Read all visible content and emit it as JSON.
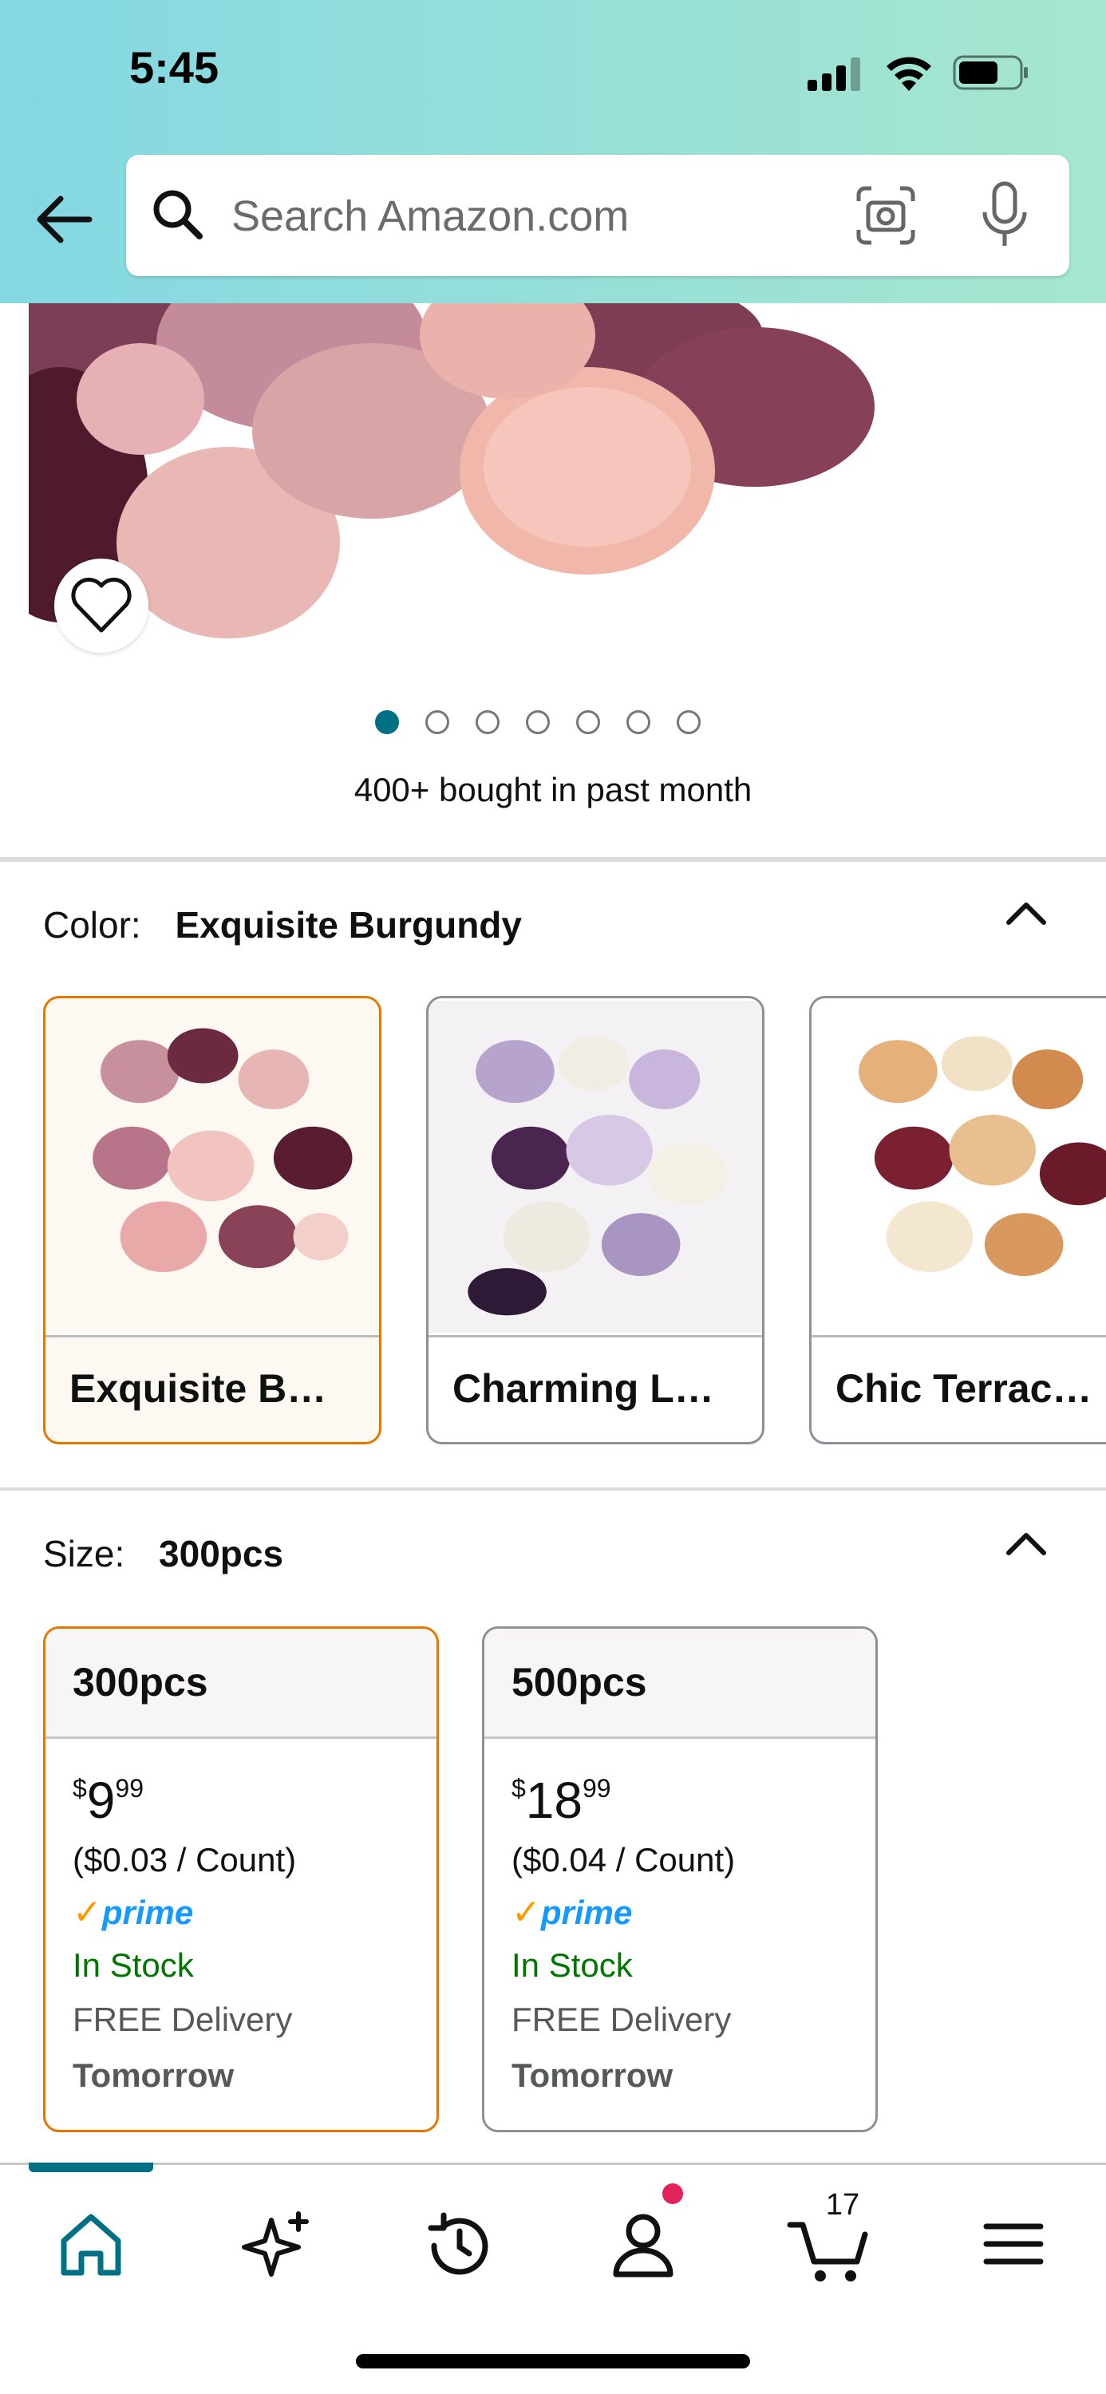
{
  "status_bar": {
    "time": "5:45"
  },
  "search": {
    "placeholder": "Search Amazon.com"
  },
  "product": {
    "image_count": 7,
    "active_image_index": 0,
    "bought_text": "400+ bought in past month"
  },
  "color_section": {
    "label": "Color:",
    "selected_value": "Exquisite Burgundy",
    "options": [
      {
        "name": "Exquisite B…",
        "selected": true
      },
      {
        "name": "Charming L…",
        "selected": false
      },
      {
        "name": "Chic Terrac…",
        "selected": false
      }
    ]
  },
  "size_section": {
    "label": "Size:",
    "selected_value": "300pcs",
    "options": [
      {
        "name": "300pcs",
        "price_symbol": "$",
        "price_whole": "9",
        "price_fraction": "99",
        "unit_price": "($0.03 / Count)",
        "prime": "prime",
        "stock": "In Stock",
        "delivery": "FREE Delivery",
        "delivery_day": "Tomorrow",
        "selected": true
      },
      {
        "name": "500pcs",
        "price_symbol": "$",
        "price_whole": "18",
        "price_fraction": "99",
        "unit_price": "($0.04 / Count)",
        "prime": "prime",
        "stock": "In Stock",
        "delivery": "FREE Delivery",
        "delivery_day": "Tomorrow",
        "selected": false
      }
    ]
  },
  "bottom_nav": {
    "items": [
      "home-icon",
      "rufus-sparkle-icon",
      "history-icon",
      "account-icon",
      "cart-icon",
      "menu-icon"
    ],
    "active": "home-icon",
    "cart_count": "17"
  },
  "colors": {
    "accent_teal": "#007185",
    "selected_border": "#e77600",
    "in_stock": "#007600",
    "prime_blue": "#1399ff",
    "notification": "#e3245c"
  }
}
